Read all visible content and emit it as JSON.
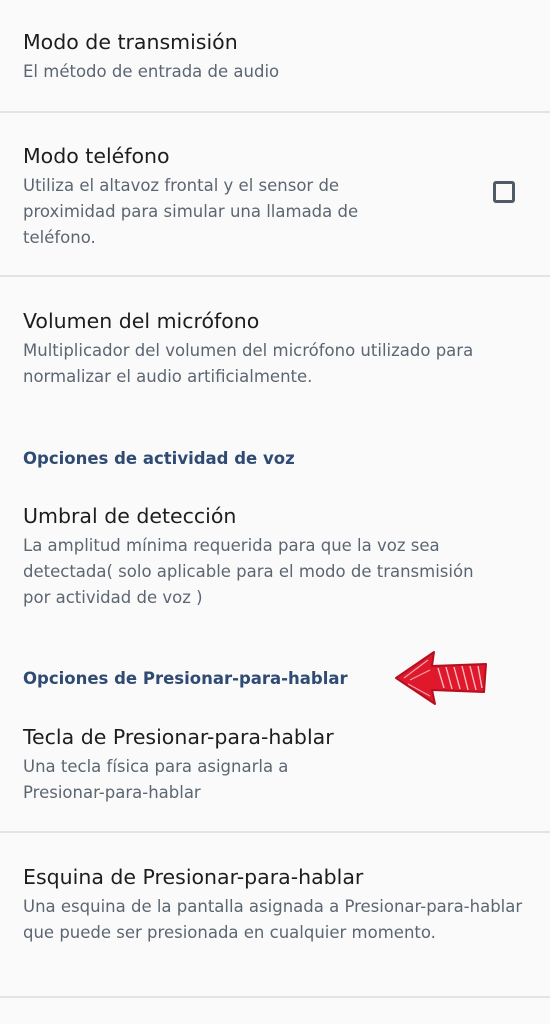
{
  "preferences": {
    "transmission_mode": {
      "title": "Modo de transmisión",
      "summary": "El método de entrada de audio"
    },
    "phone_mode": {
      "title": "Modo teléfono",
      "summary": "Utiliza el altavoz frontal y el sensor de proximidad para simular una llamada de teléfono.",
      "checked": false
    },
    "mic_volume": {
      "title": "Volumen del micrófono",
      "summary": "Multiplicador del volumen del micrófono utilizado para normalizar el audio artificialmente."
    },
    "voice_activity_category": "Opciones de actividad de voz",
    "detection_threshold": {
      "title": "Umbral de detección",
      "summary": "La amplitud mínima requerida para que la voz sea detectada( solo aplicable para el modo de transmisión por actividad de voz )"
    },
    "ptt_category": "Opciones de Presionar-para-hablar",
    "ptt_key": {
      "title": "Tecla de Presionar-para-hablar",
      "summary": "Una tecla física para asignarla a Presionar-para-hablar"
    },
    "ptt_corner": {
      "title": "Esquina de Presionar-para-hablar",
      "summary": "Una esquina de la pantalla asignada a Presionar-para-hablar que puede ser presionada en cualquier momento."
    }
  },
  "colors": {
    "background": "#fafafa",
    "title_text": "#1d1d1d",
    "summary_text": "#5c6672",
    "category_text": "#2f4a73",
    "divider": "#e2e4e6",
    "annotation_arrow": "#e0182c"
  },
  "icons": {
    "checkbox": "checkbox-unchecked-icon",
    "annotation": "red-arrow-annotation-icon"
  }
}
